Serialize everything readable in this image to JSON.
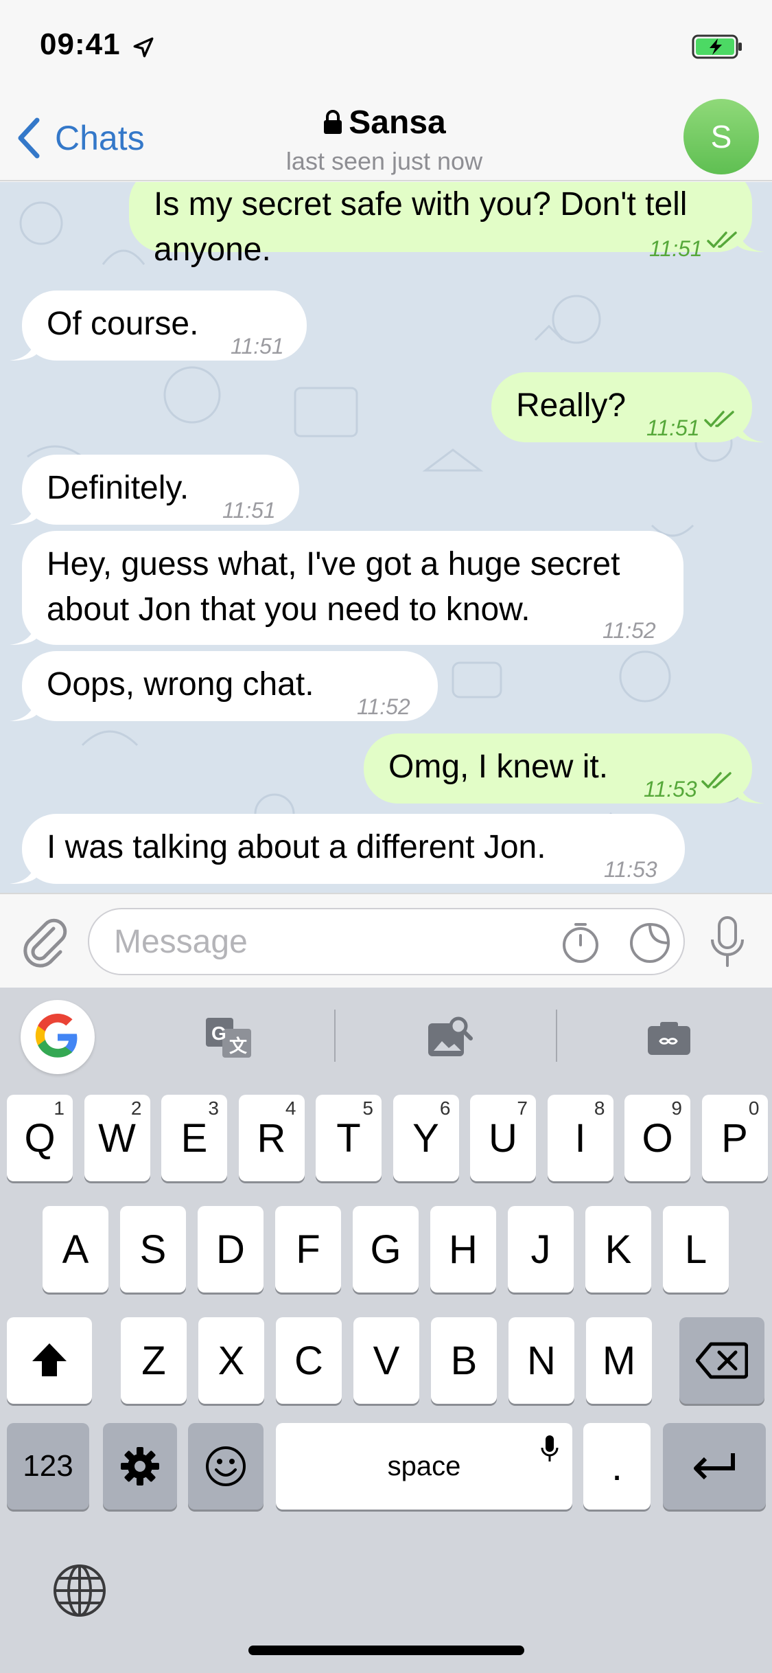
{
  "status": {
    "time": "09:41"
  },
  "nav": {
    "back_label": "Chats",
    "title": "Sansa",
    "subtitle": "last seen just now",
    "avatar_initial": "S",
    "avatar_color": "#6cc95d",
    "accent": "#3478c9"
  },
  "messages": [
    {
      "dir": "out",
      "lines": [
        "Is my secret safe with you? Don't tell",
        "anyone."
      ],
      "time": "11:51",
      "read": true
    },
    {
      "dir": "in",
      "lines": [
        "Of course."
      ],
      "time": "11:51"
    },
    {
      "dir": "out",
      "lines": [
        "Really?"
      ],
      "time": "11:51",
      "read": true
    },
    {
      "dir": "in",
      "lines": [
        "Definitely."
      ],
      "time": "11:51"
    },
    {
      "dir": "in",
      "lines": [
        "Hey, guess what, I've got a huge secret",
        "about Jon that you need to know."
      ],
      "time": "11:52"
    },
    {
      "dir": "in",
      "lines": [
        "Oops, wrong chat."
      ],
      "time": "11:52"
    },
    {
      "dir": "out",
      "lines": [
        "Omg, I knew it."
      ],
      "time": "11:53",
      "read": true
    },
    {
      "dir": "in",
      "lines": [
        "I was talking about a different Jon."
      ],
      "time": "11:53"
    }
  ],
  "input": {
    "placeholder": "Message"
  },
  "keyboard": {
    "row1": [
      {
        "label": "Q",
        "hint": "1"
      },
      {
        "label": "W",
        "hint": "2"
      },
      {
        "label": "E",
        "hint": "3"
      },
      {
        "label": "R",
        "hint": "4"
      },
      {
        "label": "T",
        "hint": "5"
      },
      {
        "label": "Y",
        "hint": "6"
      },
      {
        "label": "U",
        "hint": "7"
      },
      {
        "label": "I",
        "hint": "8"
      },
      {
        "label": "O",
        "hint": "9"
      },
      {
        "label": "P",
        "hint": "0"
      }
    ],
    "row2": [
      "A",
      "S",
      "D",
      "F",
      "G",
      "H",
      "J",
      "K",
      "L"
    ],
    "row3": [
      "Z",
      "X",
      "C",
      "V",
      "B",
      "N",
      "M"
    ],
    "numbers_label": "123",
    "space_label": "space",
    "period_label": "."
  },
  "icons": {
    "status": [
      "location-arrow-icon",
      "battery-charging-icon"
    ],
    "nav": [
      "back-chevron-icon",
      "lock-icon"
    ],
    "input": [
      "attach-icon",
      "timer-icon",
      "sticker-icon",
      "mic-icon"
    ],
    "keyboard": [
      "google-icon",
      "translate-icon",
      "image-search-icon",
      "gif-icon",
      "shift-icon",
      "backspace-icon",
      "gear-icon",
      "emoji-icon",
      "space-mic-icon",
      "return-icon",
      "globe-icon"
    ]
  }
}
